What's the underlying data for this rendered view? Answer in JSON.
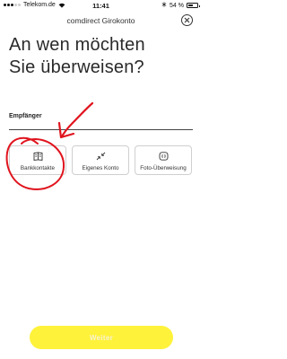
{
  "status_bar": {
    "carrier": "Telekom.de",
    "time": "11:41",
    "battery": "54 %",
    "battery_level": 0.54
  },
  "header": {
    "title": "comdirect Girokonto",
    "close_icon": "close-icon"
  },
  "page": {
    "title_line1": "An wen möchten",
    "title_line2": "Sie überweisen?"
  },
  "recipient": {
    "label": "Empfänger"
  },
  "options": [
    {
      "label": "Bankkontakte",
      "icon": "address-book-icon"
    },
    {
      "label": "Eigenes Konto",
      "icon": "arrows-in-icon"
    },
    {
      "label": "Foto-Überweisung",
      "icon": "scan-icon"
    }
  ],
  "annotation": {
    "color": "#e0141e"
  },
  "footer": {
    "submit_label": "Weiter",
    "submit_color": "#fff23a"
  }
}
